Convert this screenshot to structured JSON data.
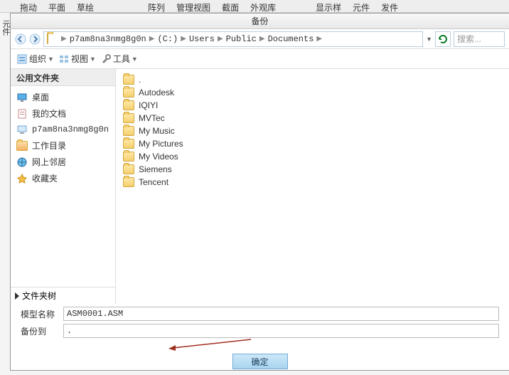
{
  "topbar": {
    "items": [
      "拖动",
      "平面",
      "",
      "草绘",
      "",
      "",
      "阵列",
      "管理视图",
      "截面",
      "外观库",
      "",
      "显示样",
      "元件",
      "发件"
    ]
  },
  "sideleft": "元件",
  "dialog": {
    "title": "备份",
    "breadcrumb": [
      "p7am8na3nmg8g0n",
      "(C:)",
      "Users",
      "Public",
      "Documents"
    ],
    "search_placeholder": "搜索...",
    "toolbar": {
      "organize": "组织",
      "view": "视图",
      "tools": "工具"
    },
    "sidebar": {
      "header": "公用文件夹",
      "items": [
        {
          "icon": "desktop",
          "label": "桌面"
        },
        {
          "icon": "docs",
          "label": "我的文档"
        },
        {
          "icon": "computer",
          "label": "p7am8na3nmg8g0n"
        },
        {
          "icon": "workdir",
          "label": "工作目录"
        },
        {
          "icon": "network",
          "label": "网上邻居"
        },
        {
          "icon": "favorites",
          "label": "收藏夹"
        }
      ],
      "footer": "文件夹树"
    },
    "files": [
      ".",
      "Autodesk",
      "IQIYI",
      "MVTec",
      "My Music",
      "My Pictures",
      "My Videos",
      "Siemens",
      "Tencent"
    ],
    "form": {
      "model_label": "模型名称",
      "model_value": "ASM0001.ASM",
      "backup_label": "备份到",
      "backup_value": "."
    },
    "ok": "确定"
  }
}
